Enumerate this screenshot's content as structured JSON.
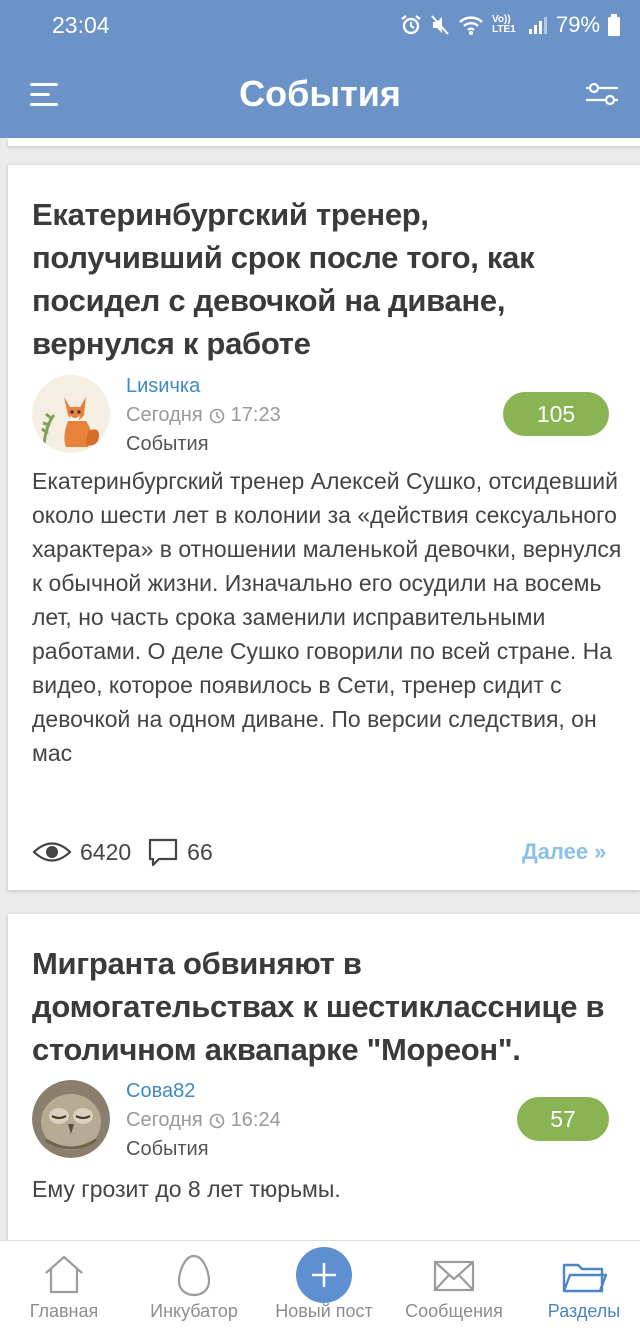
{
  "status_bar": {
    "time": "23:04",
    "network": "Vo)) LTE1",
    "battery": "79%"
  },
  "header": {
    "title": "События",
    "menu_icon": "hamburger-icon",
    "filter_icon": "filter-icon"
  },
  "posts": [
    {
      "title": "Екатеринбургский тренер, получивший срок после того, как посидел с девочкой на диване, вернулся к работе",
      "author": "Lиsичка",
      "date": "Сегодня",
      "time": "17:23",
      "category": "События",
      "score": "105",
      "excerpt": "Екатеринбургский тренер Алексей Сушко, отсидевший около шести лет в колонии за «действия сексуального характера» в отношении маленькой девочки, вернулся к обычной жизни. Изначально его осудили на восемь лет, но часть срока заменили исправительными работами. О деле Сушко говорили по всей стране. На видео, которое появилось в Сети, тренер сидит с девочкой на одном диване. По версии следствия, он мас",
      "views": "6420",
      "comments": "66",
      "more_label": "Далее »"
    },
    {
      "title": "Мигранта обвиняют в домогательствах к шестикласснице в столичном аквапарке \"Мореон\".",
      "author": "Сова82",
      "date": "Сегодня",
      "time": "16:24",
      "category": "События",
      "score": "57",
      "excerpt": "Ему грозит до 8 лет тюрьмы."
    }
  ],
  "bottom_nav": [
    {
      "label": "Главная",
      "icon": "home-icon"
    },
    {
      "label": "Инкубатор",
      "icon": "egg-icon"
    },
    {
      "label": "Новый пост",
      "icon": "plus-icon"
    },
    {
      "label": "Сообщения",
      "icon": "envelope-icon"
    },
    {
      "label": "Разделы",
      "icon": "folder-icon",
      "active": true
    }
  ],
  "colors": {
    "header": "#6b93c8",
    "score_badge": "#8ab454",
    "author_link": "#3d89c4",
    "more_link": "#8bc0e8",
    "nav_active": "#4a86c5"
  }
}
